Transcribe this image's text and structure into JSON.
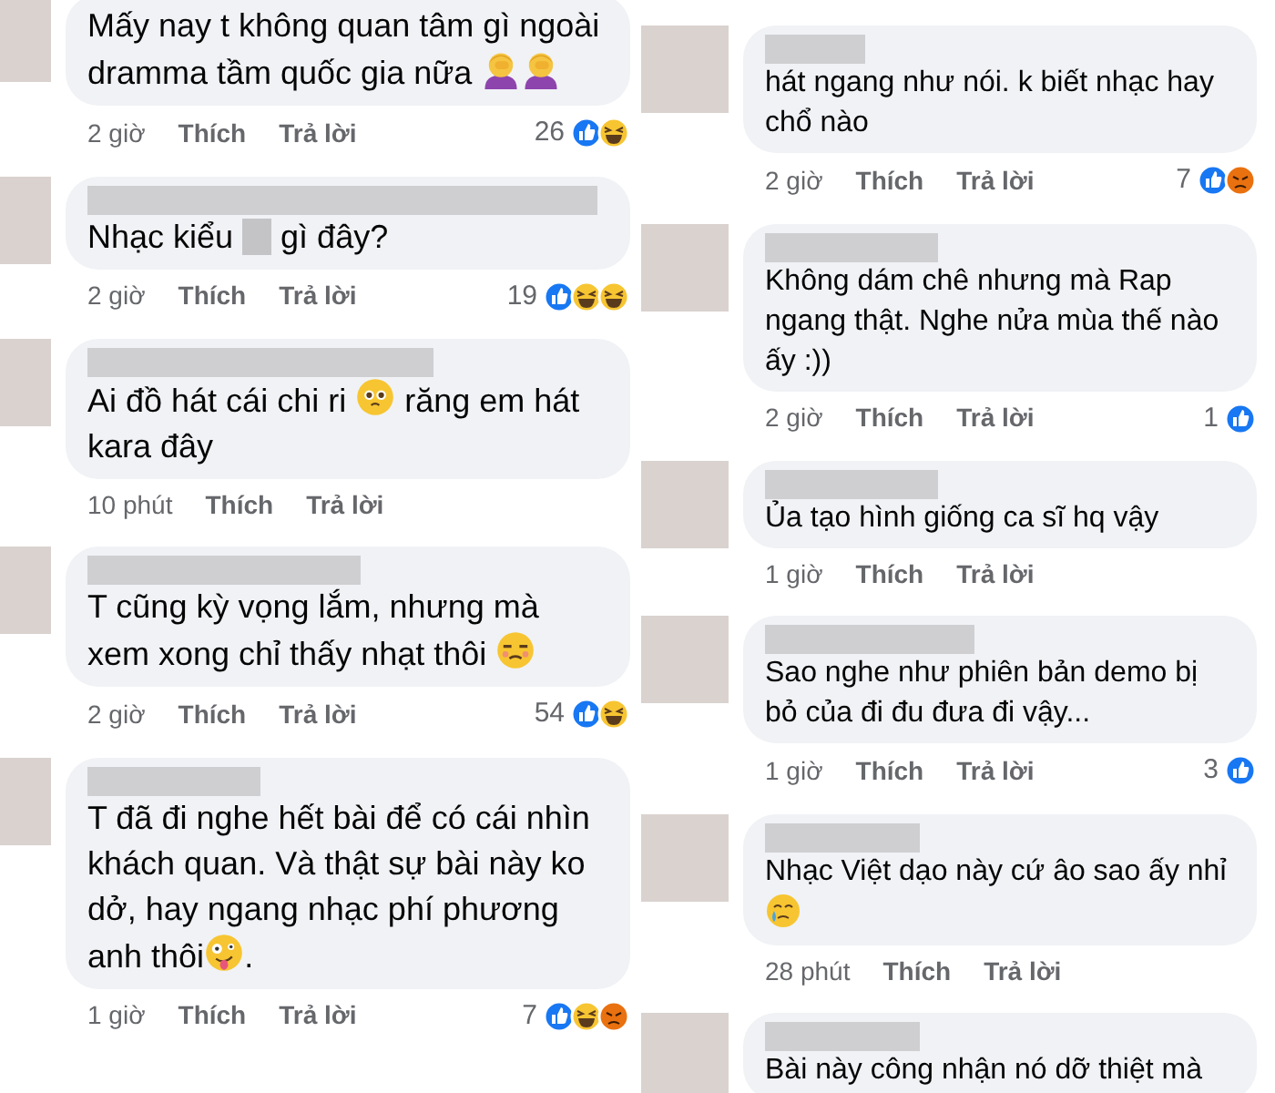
{
  "panels": [
    {
      "comments": [
        {
          "parts": [
            {
              "kind": "text",
              "text": "Mấy nay t không quan tâm gì ngoài dramma tầm quốc gia nữa "
            },
            {
              "kind": "facepalm"
            },
            {
              "kind": "facepalm"
            }
          ],
          "time": "2 giờ",
          "like_label": "Thích",
          "reply_label": "Trả lời",
          "reaction_count": "26",
          "reactions": [
            {
              "kind": "like"
            },
            {
              "kind": "haha"
            }
          ]
        },
        {
          "parts": [
            {
              "kind": "text",
              "text": "Nhạc kiểu "
            },
            {
              "kind": "censor"
            },
            {
              "kind": "text",
              "text": " gì đây?"
            }
          ],
          "time": "2 giờ",
          "like_label": "Thích",
          "reply_label": "Trả lời",
          "reaction_count": "19",
          "reactions": [
            {
              "kind": "like"
            },
            {
              "kind": "haha"
            },
            {
              "kind": "haha"
            }
          ]
        },
        {
          "parts": [
            {
              "kind": "text",
              "text": "Ai đồ hát cái chi ri "
            },
            {
              "kind": "pleading"
            },
            {
              "kind": "text",
              "text": " răng em hát kara đây"
            }
          ],
          "time": "10 phút",
          "like_label": "Thích",
          "reply_label": "Trả lời"
        },
        {
          "parts": [
            {
              "kind": "text",
              "text": "T cũng kỳ vọng lắm, nhưng mà xem xong chỉ thấy nhạt thôi "
            },
            {
              "kind": "unamused"
            }
          ],
          "time": "2 giờ",
          "like_label": "Thích",
          "reply_label": "Trả lời",
          "reaction_count": "54",
          "reactions": [
            {
              "kind": "like"
            },
            {
              "kind": "haha"
            }
          ]
        },
        {
          "parts": [
            {
              "kind": "text",
              "text": "T đã đi nghe hết bài để có cái nhìn khách quan. Và thật sự bài này ko dở, hay ngang nhạc phí phương anh thôi"
            },
            {
              "kind": "zany"
            },
            {
              "kind": "text",
              "text": "."
            }
          ],
          "time": "1 giờ",
          "like_label": "Thích",
          "reply_label": "Trả lời",
          "reaction_count": "7",
          "reactions": [
            {
              "kind": "like"
            },
            {
              "kind": "haha"
            },
            {
              "kind": "angry"
            }
          ]
        }
      ]
    },
    {
      "comments": [
        {
          "parts": [
            {
              "kind": "text",
              "text": "hát ngang như nói. k biết nhạc hay chổ nào"
            }
          ],
          "time": "2 giờ",
          "like_label": "Thích",
          "reply_label": "Trả lời",
          "reaction_count": "7",
          "reactions": [
            {
              "kind": "like"
            },
            {
              "kind": "angry"
            }
          ]
        },
        {
          "parts": [
            {
              "kind": "text",
              "text": "Không dám chê nhưng mà Rap ngang thật. Nghe nửa mùa thế nào ấy :))"
            }
          ],
          "time": "2 giờ",
          "like_label": "Thích",
          "reply_label": "Trả lời",
          "reaction_count": "1",
          "reactions": [
            {
              "kind": "like"
            }
          ]
        },
        {
          "parts": [
            {
              "kind": "text",
              "text": "Ủa tạo hình giống ca sĩ hq vậy"
            }
          ],
          "time": "1 giờ",
          "like_label": "Thích",
          "reply_label": "Trả lời"
        },
        {
          "parts": [
            {
              "kind": "text",
              "text": "Sao nghe như phiên bản demo bị bỏ của đi đu đưa đi vậy..."
            }
          ],
          "time": "1 giờ",
          "like_label": "Thích",
          "reply_label": "Trả lời",
          "reaction_count": "3",
          "reactions": [
            {
              "kind": "like"
            }
          ]
        },
        {
          "parts": [
            {
              "kind": "text",
              "text": "Nhạc Việt dạo này cứ âo sao ấy nhỉ "
            },
            {
              "kind": "crying"
            }
          ],
          "time": "28 phút",
          "like_label": "Thích",
          "reply_label": "Trả lời"
        },
        {
          "parts": [
            {
              "kind": "text",
              "text": "Bài này công nhận nó dỡ thiệt mà"
            }
          ]
        }
      ]
    }
  ]
}
